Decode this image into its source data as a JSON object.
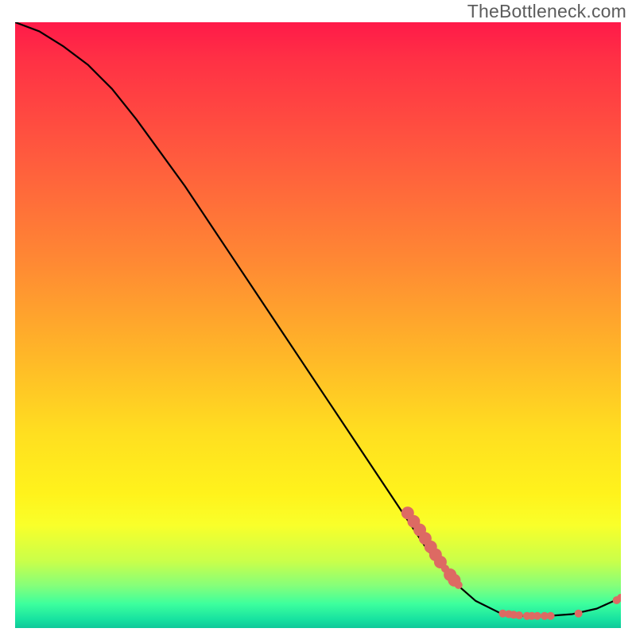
{
  "watermark": "TheBottleneck.com",
  "chart_data": {
    "type": "line",
    "title": "",
    "xlabel": "",
    "ylabel": "",
    "xlim": [
      0,
      100
    ],
    "ylim": [
      0,
      100
    ],
    "grid": false,
    "legend": false,
    "curve": {
      "x": [
        0,
        4,
        8,
        12,
        16,
        20,
        24,
        28,
        32,
        36,
        40,
        44,
        48,
        52,
        56,
        60,
        64,
        68,
        72,
        76,
        80,
        84,
        88,
        92,
        96,
        100
      ],
      "y": [
        100,
        98.5,
        96,
        93,
        89,
        84,
        78.5,
        73,
        67,
        61,
        55,
        49,
        43,
        37,
        31,
        25,
        19,
        13,
        8,
        4.5,
        2.5,
        2,
        2,
        2.3,
        3.2,
        5
      ]
    },
    "markers": {
      "color": "#dd6a63",
      "radius_small": 5,
      "radius_large": 8,
      "points": [
        {
          "x": 64.8,
          "y": 19.0,
          "r": "large"
        },
        {
          "x": 65.8,
          "y": 17.6,
          "r": "large"
        },
        {
          "x": 66.8,
          "y": 16.2,
          "r": "large"
        },
        {
          "x": 67.7,
          "y": 14.8,
          "r": "large"
        },
        {
          "x": 68.6,
          "y": 13.4,
          "r": "large"
        },
        {
          "x": 69.4,
          "y": 12.1,
          "r": "large"
        },
        {
          "x": 70.2,
          "y": 10.9,
          "r": "large"
        },
        {
          "x": 71.0,
          "y": 9.8,
          "r": "small"
        },
        {
          "x": 71.8,
          "y": 8.8,
          "r": "large"
        },
        {
          "x": 72.5,
          "y": 7.9,
          "r": "large"
        },
        {
          "x": 73.2,
          "y": 7.1,
          "r": "small"
        },
        {
          "x": 80.5,
          "y": 2.4,
          "r": "small"
        },
        {
          "x": 81.5,
          "y": 2.3,
          "r": "small"
        },
        {
          "x": 82.3,
          "y": 2.2,
          "r": "small"
        },
        {
          "x": 83.2,
          "y": 2.1,
          "r": "small"
        },
        {
          "x": 84.5,
          "y": 2.0,
          "r": "small"
        },
        {
          "x": 85.3,
          "y": 2.0,
          "r": "small"
        },
        {
          "x": 86.2,
          "y": 2.0,
          "r": "small"
        },
        {
          "x": 87.4,
          "y": 2.0,
          "r": "small"
        },
        {
          "x": 88.4,
          "y": 2.0,
          "r": "small"
        },
        {
          "x": 93.0,
          "y": 2.4,
          "r": "small"
        },
        {
          "x": 99.3,
          "y": 4.6,
          "r": "small"
        },
        {
          "x": 100.0,
          "y": 5.0,
          "r": "small"
        }
      ]
    }
  }
}
